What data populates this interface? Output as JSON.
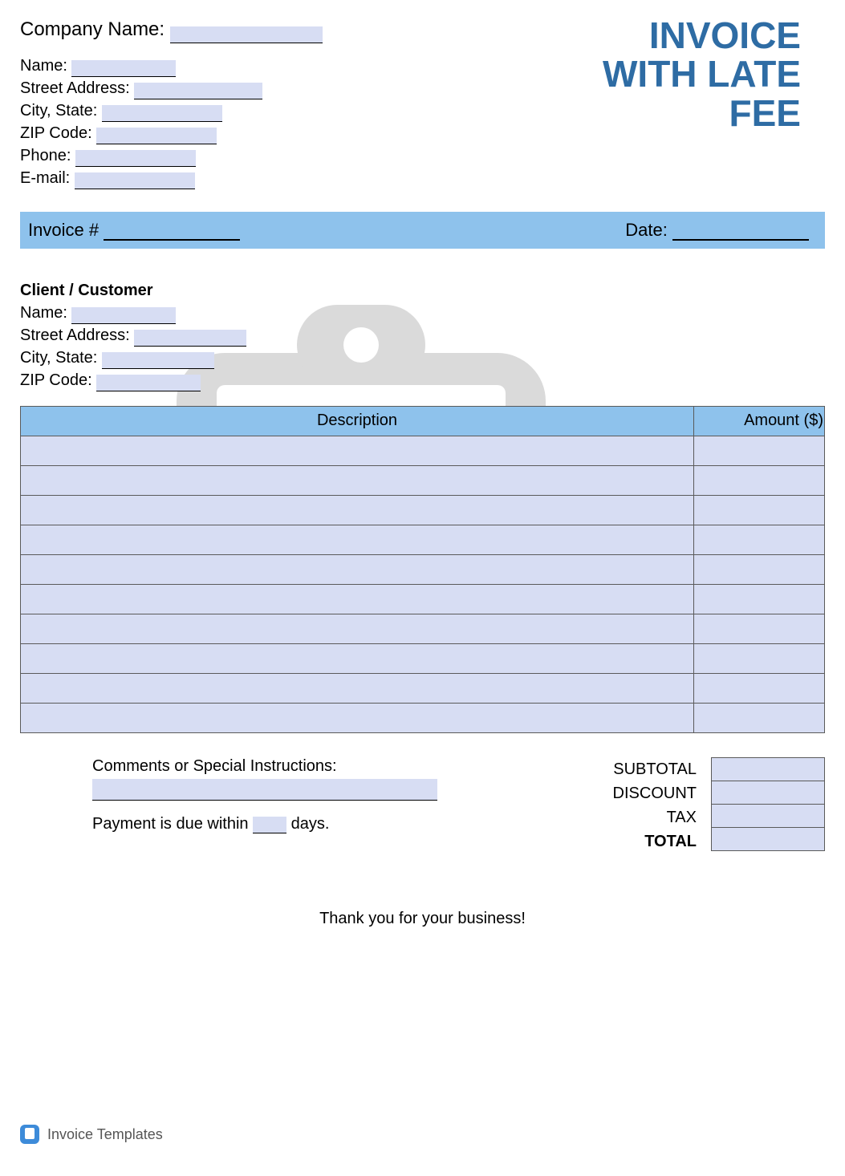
{
  "title": {
    "line1": "INVOICE",
    "line2": "WITH LATE",
    "line3": "FEE"
  },
  "company": {
    "name_label": "Company Name:",
    "name": "",
    "sender": {
      "name_label": "Name:",
      "name": "",
      "street_label": "Street Address:",
      "street": "",
      "city_state_label": "City, State:",
      "city_state": "",
      "zip_label": "ZIP Code:",
      "zip": "",
      "phone_label": "Phone:",
      "phone": "",
      "email_label": "E-mail:",
      "email": ""
    }
  },
  "invoice_bar": {
    "number_label": "Invoice #",
    "number": "",
    "date_label": "Date:",
    "date": ""
  },
  "client": {
    "heading": "Client / Customer",
    "name_label": "Name:",
    "name": "",
    "street_label": "Street Address:",
    "street": "",
    "city_state_label": "City, State:",
    "city_state": "",
    "zip_label": "ZIP Code:",
    "zip": ""
  },
  "table": {
    "headers": {
      "description": "Description",
      "amount": "Amount ($)"
    },
    "rows": [
      {
        "description": "",
        "amount": ""
      },
      {
        "description": "",
        "amount": ""
      },
      {
        "description": "",
        "amount": ""
      },
      {
        "description": "",
        "amount": ""
      },
      {
        "description": "",
        "amount": ""
      },
      {
        "description": "",
        "amount": ""
      },
      {
        "description": "",
        "amount": ""
      },
      {
        "description": "",
        "amount": ""
      },
      {
        "description": "",
        "amount": ""
      },
      {
        "description": "",
        "amount": ""
      }
    ]
  },
  "comments": {
    "label": "Comments or Special Instructions:",
    "text": "",
    "due_prefix": "Payment is due within",
    "due_days": "",
    "due_suffix": "days."
  },
  "totals": {
    "subtotal_label": "SUBTOTAL",
    "subtotal": "",
    "discount_label": "DISCOUNT",
    "discount": "",
    "tax_label": "TAX",
    "tax": "",
    "total_label": "TOTAL",
    "total": ""
  },
  "thanks": "Thank you for your business!",
  "footer_brand": "Invoice Templates"
}
